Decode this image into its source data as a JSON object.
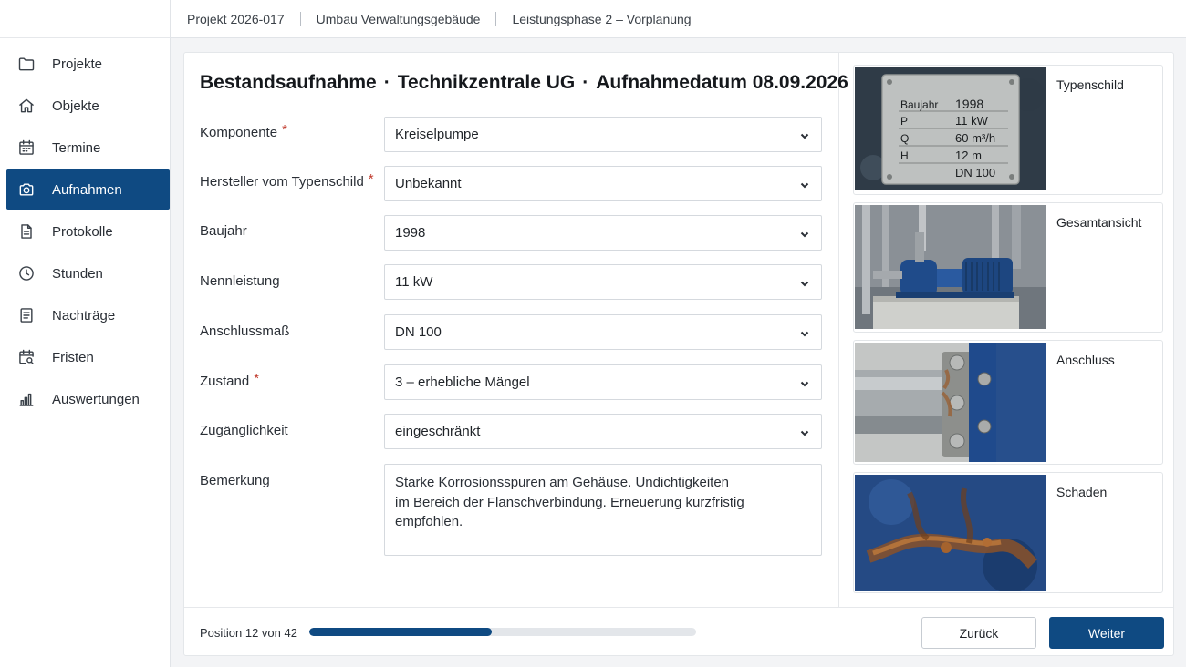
{
  "breadcrumb": [
    "Projekt 2026-017",
    "Umbau Verwaltungsgebäude",
    "Leistungsphase 2 – Vorplanung"
  ],
  "sidebar": {
    "items": [
      {
        "label": "Projekte",
        "icon": "folder-icon"
      },
      {
        "label": "Objekte",
        "icon": "home-icon"
      },
      {
        "label": "Termine",
        "icon": "calendar-icon"
      },
      {
        "label": "Aufnahmen",
        "icon": "camera-icon",
        "active": true
      },
      {
        "label": "Protokolle",
        "icon": "document-icon"
      },
      {
        "label": "Stunden",
        "icon": "clock-icon"
      },
      {
        "label": "Nachträge",
        "icon": "list-document-icon"
      },
      {
        "label": "Fristen",
        "icon": "calendar-search-icon"
      },
      {
        "label": "Auswertungen",
        "icon": "bar-chart-icon"
      }
    ]
  },
  "header": {
    "title_part1": "Bestandsaufnahme",
    "title_part2": "Technikzentrale UG",
    "title_part3": "Aufnahmedatum 08.09.2026",
    "separator": "·"
  },
  "form": {
    "required_marker": "*",
    "fields": [
      {
        "label": "Komponente",
        "value": "Kreiselpumpe",
        "required": true
      },
      {
        "label": "Hersteller vom Typenschild",
        "value": "Unbekannt",
        "required": true
      },
      {
        "label": "Baujahr",
        "value": "1998",
        "required": false
      },
      {
        "label": "Nennleistung",
        "value": "11 kW",
        "required": false
      },
      {
        "label": "Anschlussmaß",
        "value": "DN 100",
        "required": false
      },
      {
        "label": "Zustand",
        "value": "3 – erhebliche Mängel",
        "required": true
      },
      {
        "label": "Zugänglichkeit",
        "value": "eingeschränkt",
        "required": false
      }
    ],
    "remark_label": "Bemerkung",
    "remark_value": "Starke Korrosionsspuren am Gehäuse. Undichtigkeiten\nim Bereich der Flanschverbindung. Erneuerung kurzfristig\nempfohlen."
  },
  "photos": {
    "items": [
      {
        "label": "Typenschild"
      },
      {
        "label": "Gesamtansicht"
      },
      {
        "label": "Anschluss"
      },
      {
        "label": "Schaden"
      }
    ],
    "nameplate": {
      "row1_key": "Baujahr",
      "row1_val": "1998",
      "row2_key": "P",
      "row2_val": "11  kW",
      "row3_key": "Q",
      "row3_val": "60  m³/h",
      "row4_key": "H",
      "row4_val": "12  m",
      "row5_val": "DN  100"
    }
  },
  "footer": {
    "position_text": "Position 12 von 42",
    "progress_fraction": 0.4714,
    "back_label": "Zurück",
    "next_label": "Weiter"
  },
  "colors": {
    "accent": "#0f4a82",
    "required": "#c0392b"
  }
}
